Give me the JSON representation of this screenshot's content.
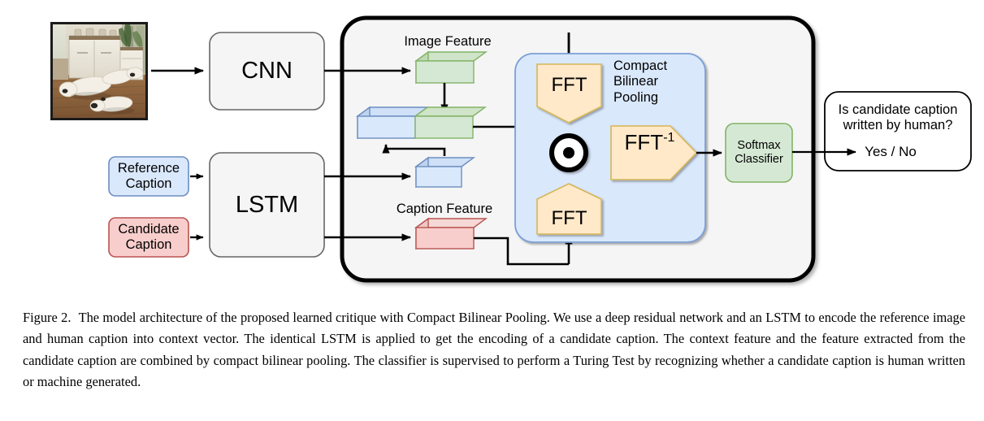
{
  "figure": {
    "source_image": {
      "alt": "photograph of two white dogs lying on a wooden floor in a room with white cabinets"
    },
    "encoders": {
      "cnn_label": "CNN",
      "lstm_label": "LSTM"
    },
    "inputs": {
      "reference_caption": "Reference\nCaption",
      "reference_caption_line1": "Reference",
      "reference_caption_line2": "Caption",
      "candidate_caption_line1": "Candidate",
      "candidate_caption_line2": "Caption"
    },
    "features": {
      "image_feature_label": "Image Feature",
      "caption_feature_label": "Caption Feature"
    },
    "pooling": {
      "title_line1": "Compact",
      "title_line2": "Bilinear",
      "title_line3": "Pooling",
      "fft_top_label": "FFT",
      "fft_bottom_label": "FFT",
      "ifft_label": "FFT",
      "ifft_superscript": "-1",
      "operator_label": "elementwise-product"
    },
    "classifier": {
      "line1": "Softmax",
      "line2": "Classifier"
    },
    "output": {
      "question_line1": "Is candidate caption",
      "question_line2": "written by human?",
      "answer": "Yes / No"
    },
    "colors": {
      "green_fill": "#d5e8d4",
      "green_stroke": "#82b366",
      "blue_fill": "#dae8fc",
      "blue_stroke": "#6c8ebf",
      "red_fill": "#f8cecc",
      "red_stroke": "#b85450",
      "yellow_fill": "#ffe6cc",
      "yellow_stroke": "#d6b656",
      "panel_fill": "#dae8fc",
      "grey_fill": "#f5f5f5",
      "stroke_dark": "#000000"
    }
  },
  "caption": {
    "label": "Figure 2.",
    "text": "The model architecture of the proposed learned critique with Compact Bilinear Pooling. We use a deep residual network and an LSTM to encode the reference image and human caption into context vector. The identical LSTM is applied to get the encoding of a candidate caption. The context feature and the feature extracted from the candidate caption are combined by compact bilinear pooling. The classifier is supervised to perform a Turing Test by recognizing whether a candidate caption is human written or machine generated."
  }
}
